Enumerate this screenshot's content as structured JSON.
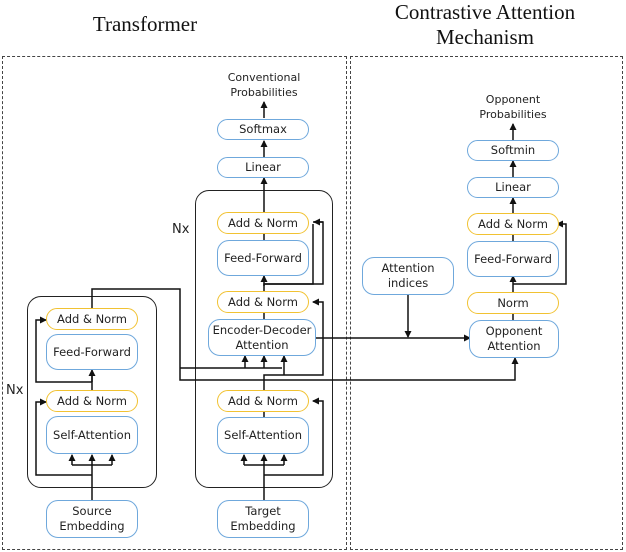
{
  "titles": {
    "transformer": "Transformer",
    "contrastive_line1": "Contrastive Attention",
    "contrastive_line2": "Mechanism"
  },
  "encoder": {
    "repeat_label": "Nx",
    "add_norm_top": "Add & Norm",
    "feed_forward": "Feed-Forward",
    "add_norm_bottom": "Add & Norm",
    "self_attention": "Self-Attention",
    "embedding_line1": "Source",
    "embedding_line2": "Embedding"
  },
  "decoder": {
    "repeat_label": "Nx",
    "output_line1": "Conventional",
    "output_line2": "Probabilities",
    "softmax": "Softmax",
    "linear": "Linear",
    "add_norm_top": "Add & Norm",
    "feed_forward": "Feed-Forward",
    "add_norm_mid": "Add & Norm",
    "enc_dec_line1": "Encoder-Decoder",
    "enc_dec_line2": "Attention",
    "add_norm_bottom": "Add & Norm",
    "self_attention": "Self-Attention",
    "embedding_line1": "Target",
    "embedding_line2": "Embedding"
  },
  "contrastive": {
    "output_line1": "Opponent",
    "output_line2": "Probabilities",
    "softmin": "Softmin",
    "linear": "Linear",
    "add_norm": "Add & Norm",
    "feed_forward": "Feed-Forward",
    "norm": "Norm",
    "opponent_line1": "Opponent",
    "opponent_line2": "Attention",
    "indices_line1": "Attention",
    "indices_line2": "indices"
  },
  "colors": {
    "sublayer_border": "#6fa8dc",
    "norm_border": "#f1c232",
    "line": "#111111"
  }
}
